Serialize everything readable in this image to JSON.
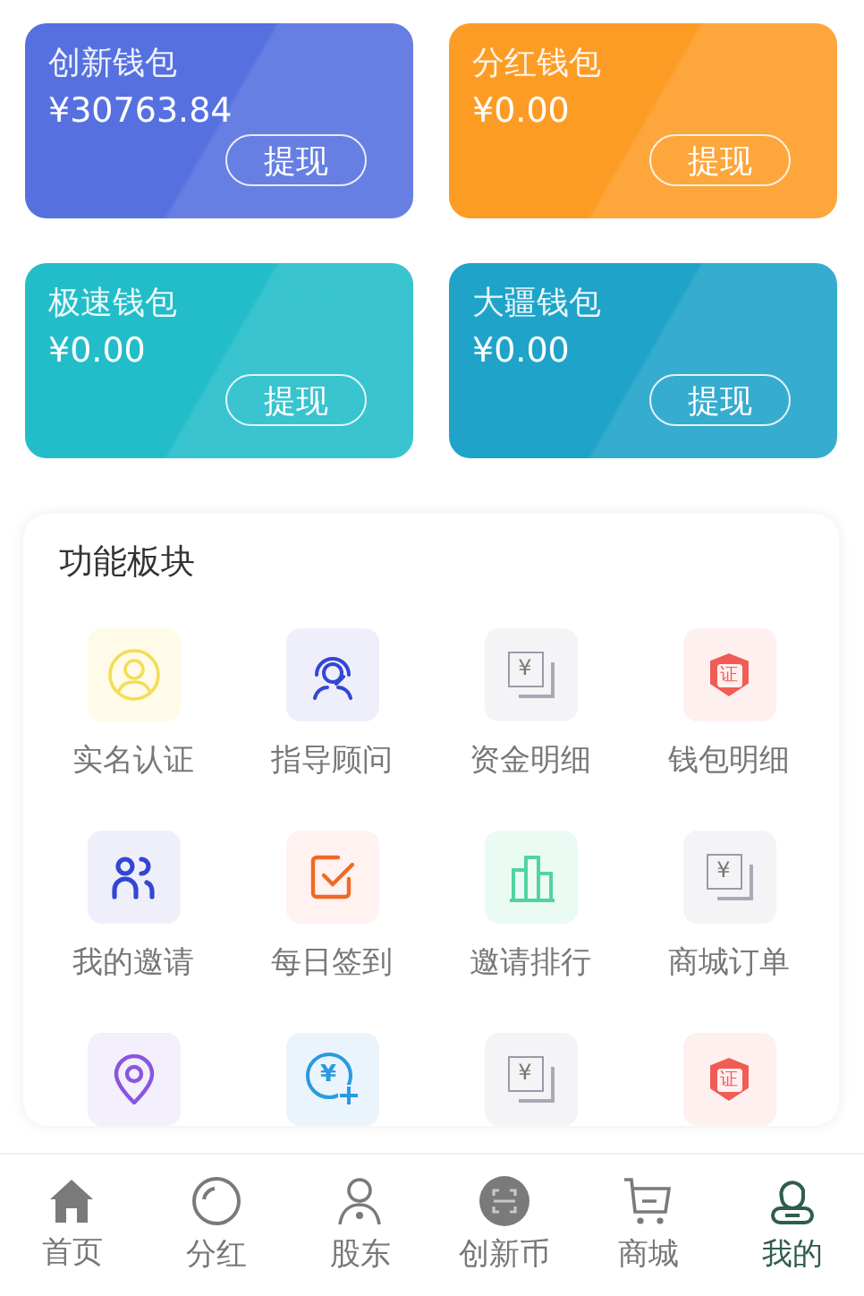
{
  "wallets": [
    {
      "name": "创新钱包",
      "amount": "¥30763.84",
      "button": "提现",
      "color": "#5670e0"
    },
    {
      "name": "分红钱包",
      "amount": "¥0.00",
      "button": "提现",
      "color": "#fd9c25"
    },
    {
      "name": "极速钱包",
      "amount": "¥0.00",
      "button": "提现",
      "color": "#22bdc9"
    },
    {
      "name": "大疆钱包",
      "amount": "¥0.00",
      "button": "提现",
      "color": "#1fa3c9"
    }
  ],
  "features": {
    "title": "功能板块",
    "items": [
      {
        "label": "实名认证",
        "kind": "person"
      },
      {
        "label": "指导顾问",
        "kind": "headset"
      },
      {
        "label": "资金明细",
        "kind": "bill",
        "glyph": "¥"
      },
      {
        "label": "钱包明细",
        "kind": "shield",
        "glyph": "证"
      },
      {
        "label": "我的邀请",
        "kind": "people"
      },
      {
        "label": "每日签到",
        "kind": "check"
      },
      {
        "label": "邀请排行",
        "kind": "bars"
      },
      {
        "label": "商城订单",
        "kind": "bill",
        "glyph": "¥"
      },
      {
        "kind": "pin"
      },
      {
        "kind": "coin",
        "glyph": "¥"
      },
      {
        "kind": "bill",
        "glyph": "¥"
      },
      {
        "kind": "shield",
        "glyph": "证"
      }
    ]
  },
  "tabbar": [
    {
      "label": "首页",
      "kind": "home",
      "selected": false
    },
    {
      "label": "分红",
      "kind": "ring",
      "selected": false
    },
    {
      "label": "股东",
      "kind": "user",
      "selected": false
    },
    {
      "label": "创新币",
      "kind": "scan",
      "selected": false
    },
    {
      "label": "商城",
      "kind": "cart",
      "selected": false
    },
    {
      "label": "我的",
      "kind": "profile",
      "selected": true
    }
  ]
}
